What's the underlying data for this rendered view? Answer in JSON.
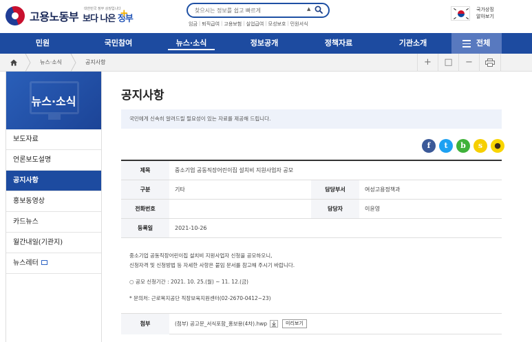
{
  "header": {
    "logo_text": "고용노동부",
    "slogan_small": "대한민국 정부 상징입니다",
    "slogan_main_1": "보다 나은",
    "slogan_main_2": "정부",
    "search_placeholder": "찾으시는 정보를 쉽고 빠르게",
    "quick_links": [
      "임금",
      "퇴직급여",
      "고용보험",
      "실업급여",
      "모성보호",
      "민원서식"
    ],
    "symbol_line1": "국가상징",
    "symbol_line2": "알아보기"
  },
  "nav": {
    "items": [
      "민원",
      "국민참여",
      "뉴스·소식",
      "정보공개",
      "정책자료",
      "기관소개"
    ],
    "active_index": 2,
    "all_label": "전체"
  },
  "breadcrumb": {
    "items": [
      "뉴스·소식",
      "공지사항"
    ],
    "tools": [
      "+",
      "□",
      "−",
      "print"
    ]
  },
  "sidebar": {
    "title": "뉴스·소식",
    "items": [
      {
        "label": "보도자료",
        "active": false
      },
      {
        "label": "언론보도설명",
        "active": false
      },
      {
        "label": "공지사항",
        "active": true
      },
      {
        "label": "홍보동영상",
        "active": false
      },
      {
        "label": "카드뉴스",
        "active": false
      },
      {
        "label": "월간내일(기관지)",
        "active": false
      },
      {
        "label": "뉴스레터",
        "active": false,
        "external": true
      }
    ]
  },
  "content": {
    "page_title": "공지사항",
    "intro": "국민에게 신속히 알려드릴 필요성이 있는 자료를 제공해 드립니다.",
    "shares": [
      {
        "name": "facebook",
        "glyph": "f",
        "color": "#3b5998"
      },
      {
        "name": "twitter",
        "glyph": "t",
        "color": "#1da1f2"
      },
      {
        "name": "band",
        "glyph": "b",
        "color": "#3fb23a"
      },
      {
        "name": "kakaostory",
        "glyph": "s",
        "color": "#f6cf00"
      },
      {
        "name": "kakaotalk",
        "glyph": "●",
        "color": "#f9d500"
      }
    ],
    "table": {
      "title_label": "제목",
      "title_value": "중소기업 공동직장어린이집 설치비 지원사업자 공모",
      "category_label": "구분",
      "category_value": "기타",
      "dept_label": "담당부서",
      "dept_value": "여성고용정책과",
      "phone_label": "전화번호",
      "phone_value": "",
      "person_label": "담당자",
      "person_value": "이윤영",
      "date_label": "등록일",
      "date_value": "2021-10-26"
    },
    "body": {
      "line1": "중소기업 공동직장어린이집 설치비 지원사업자 신청을 공모하오니,",
      "line2": "신청자격 및 신청방법 등 자세한 사항은 붙임 문서를 참고해 주시기 바랍니다.",
      "period": "○ 공모 신청기간 : 2021. 10. 25.(월) ~ 11. 12.(금)",
      "contact": "* 문의처: 근로복지공단 직장보육지원센터(02-2670-0412~23)"
    },
    "attach": {
      "label": "첨부",
      "file": "(첨부) 공고문_서식포함_홍보용(4차).hwp",
      "preview_label": "미리보기"
    }
  }
}
